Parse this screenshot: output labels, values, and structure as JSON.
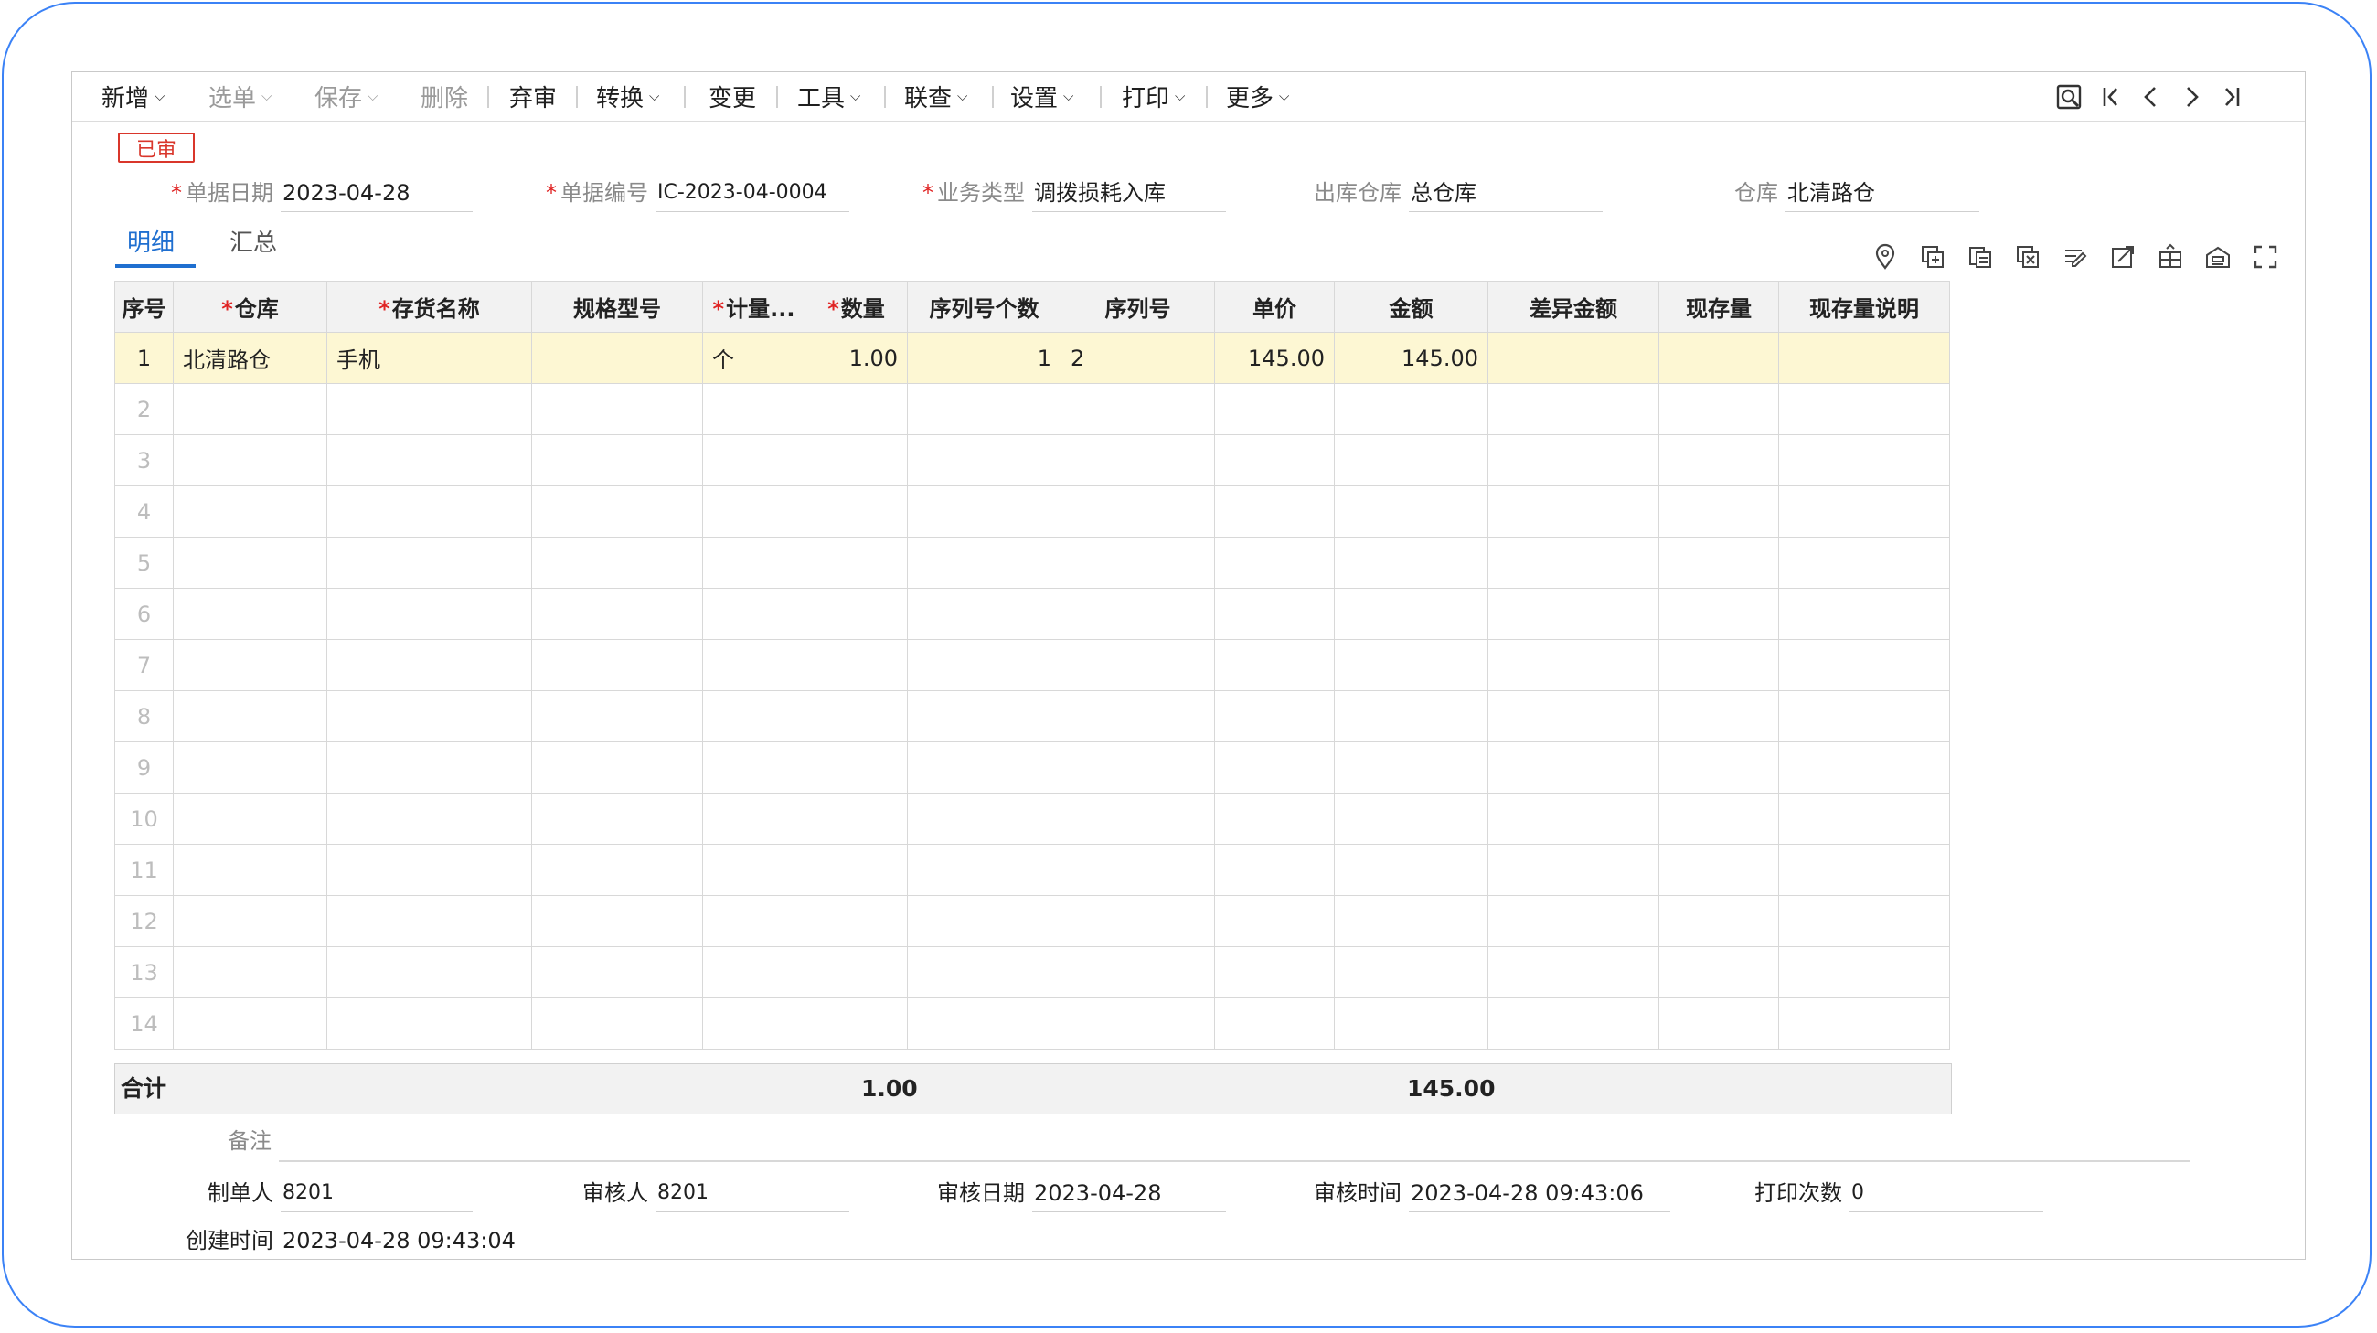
{
  "toolbar": {
    "items": [
      {
        "label": "新增",
        "dropdown": true,
        "enabled": true
      },
      {
        "label": "选单",
        "dropdown": true,
        "enabled": false
      },
      {
        "label": "保存",
        "dropdown": true,
        "enabled": false
      },
      {
        "label": "删除",
        "dropdown": false,
        "enabled": false
      },
      {
        "label": "弃审",
        "dropdown": false,
        "enabled": true
      },
      {
        "label": "转换",
        "dropdown": true,
        "enabled": true
      },
      {
        "label": "变更",
        "dropdown": false,
        "enabled": true
      },
      {
        "label": "工具",
        "dropdown": true,
        "enabled": true
      },
      {
        "label": "联查",
        "dropdown": true,
        "enabled": true
      },
      {
        "label": "设置",
        "dropdown": true,
        "enabled": true
      },
      {
        "label": "打印",
        "dropdown": true,
        "enabled": true
      },
      {
        "label": "更多",
        "dropdown": true,
        "enabled": true
      }
    ],
    "nav_icons": [
      "search-doc-icon",
      "first-record-icon",
      "prev-record-icon",
      "next-record-icon",
      "last-record-icon"
    ]
  },
  "status_badge": "已审",
  "header": {
    "date": {
      "label": "单据日期",
      "value": "2023-04-28",
      "required": true
    },
    "doc_no": {
      "label": "单据编号",
      "value": "IC-2023-04-0004",
      "required": true
    },
    "biz_type": {
      "label": "业务类型",
      "value": "调拨损耗入库",
      "required": true
    },
    "out_wh": {
      "label": "出库仓库",
      "value": "总仓库",
      "required": false
    },
    "wh": {
      "label": "仓库",
      "value": "北清路仓",
      "required": false
    }
  },
  "tabs": {
    "detail": "明细",
    "summary": "汇总"
  },
  "grid_tools": [
    "location-icon",
    "insert-row-icon",
    "copy-row-icon",
    "delete-row-icon",
    "edit-row-icon",
    "export-icon",
    "column-setting-icon",
    "warehouse-icon",
    "fullscreen-icon"
  ],
  "table": {
    "columns": [
      {
        "label": "序号",
        "required": false
      },
      {
        "label": "仓库",
        "required": true
      },
      {
        "label": "存货名称",
        "required": true
      },
      {
        "label": "规格型号",
        "required": false
      },
      {
        "label": "计量...",
        "required": true
      },
      {
        "label": "数量",
        "required": true
      },
      {
        "label": "序列号个数",
        "required": false
      },
      {
        "label": "序列号",
        "required": false
      },
      {
        "label": "单价",
        "required": false
      },
      {
        "label": "金额",
        "required": false
      },
      {
        "label": "差异金额",
        "required": false
      },
      {
        "label": "现存量",
        "required": false
      },
      {
        "label": "现存量说明",
        "required": false
      }
    ],
    "rows": [
      {
        "idx": "1",
        "warehouse": "北清路仓",
        "item": "手机",
        "spec": "",
        "unit": "个",
        "qty": "1.00",
        "sn_count": "1",
        "sn": "2",
        "price": "145.00",
        "amount": "145.00",
        "diff": "",
        "stock": "",
        "stock_note": ""
      },
      {
        "idx": "2"
      },
      {
        "idx": "3"
      },
      {
        "idx": "4"
      },
      {
        "idx": "5"
      },
      {
        "idx": "6"
      },
      {
        "idx": "7"
      },
      {
        "idx": "8"
      },
      {
        "idx": "9"
      },
      {
        "idx": "10"
      },
      {
        "idx": "11"
      },
      {
        "idx": "12"
      },
      {
        "idx": "13"
      },
      {
        "idx": "14"
      }
    ]
  },
  "totals": {
    "label": "合计",
    "qty": "1.00",
    "amount": "145.00"
  },
  "remark_label": "备注",
  "footer": {
    "maker": {
      "label": "制单人",
      "value": "8201"
    },
    "auditor": {
      "label": "审核人",
      "value": "8201"
    },
    "audit_date": {
      "label": "审核日期",
      "value": "2023-04-28"
    },
    "audit_time": {
      "label": "审核时间",
      "value": "2023-04-28 09:43:06"
    },
    "print_count": {
      "label": "打印次数",
      "value": "0"
    },
    "create_time": {
      "label": "创建时间",
      "value": "2023-04-28 09:43:04"
    }
  },
  "colors": {
    "accent": "#1f6fd0",
    "required": "#e02424",
    "badge": "#d9362b",
    "selected_row": "#fdf7d3",
    "frame": "#3b82f6"
  }
}
